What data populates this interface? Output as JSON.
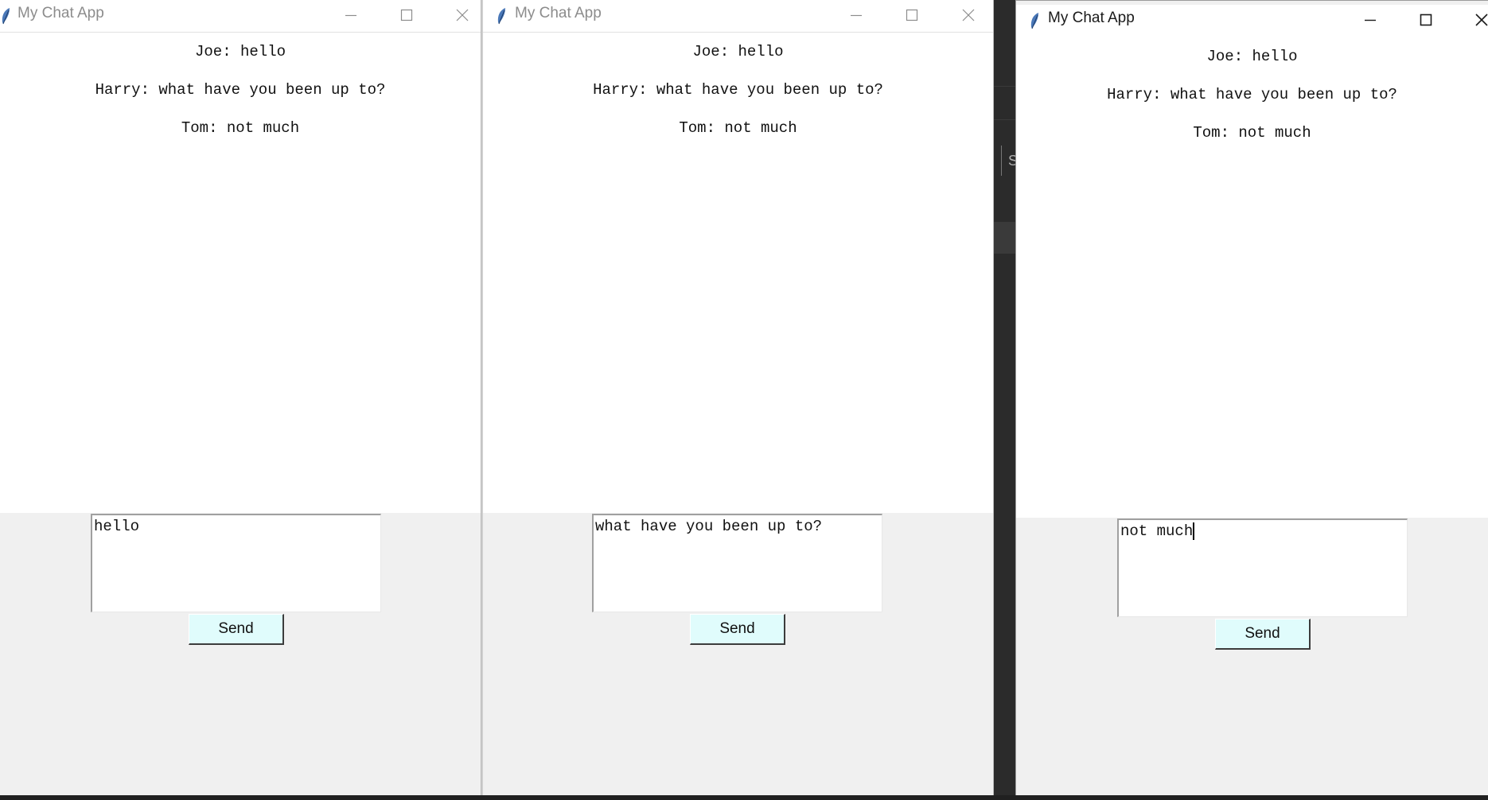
{
  "windows": [
    {
      "title": "My Chat App",
      "messages": [
        "Joe: hello",
        "Harry: what have you been up to?",
        "Tom: not much"
      ],
      "input_value": "hello",
      "send_label": "Send"
    },
    {
      "title": "My Chat App",
      "messages": [
        "Joe: hello",
        "Harry: what have you been up to?",
        "Tom: not much"
      ],
      "input_value": "what have you been up to?",
      "send_label": "Send"
    },
    {
      "title": "My Chat App",
      "messages": [
        "Joe: hello",
        "Harry: what have you been up to?",
        "Tom: not much"
      ],
      "input_value": "not much",
      "send_label": "Send"
    }
  ],
  "background": {
    "partial_text": "S"
  },
  "icons": {
    "app": "feather-icon",
    "minimize": "minimize-icon",
    "maximize": "maximize-icon",
    "close": "close-icon"
  },
  "colors": {
    "send_button_bg": "#e0fcfc",
    "chat_bg": "#ffffff",
    "window_bg": "#f0f0f0"
  }
}
